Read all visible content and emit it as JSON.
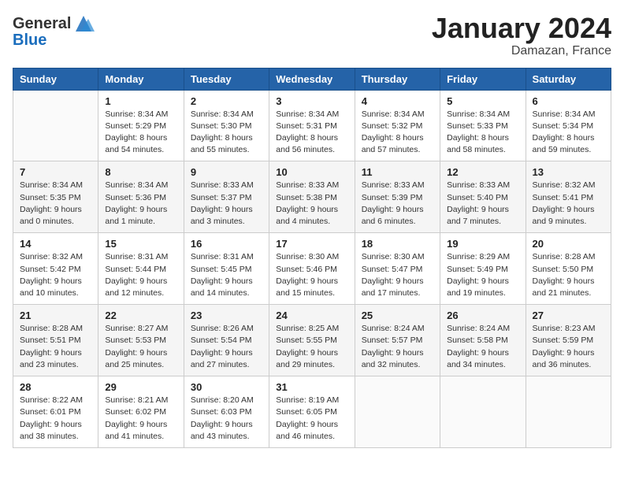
{
  "header": {
    "logo_general": "General",
    "logo_blue": "Blue",
    "month": "January 2024",
    "location": "Damazan, France"
  },
  "weekdays": [
    "Sunday",
    "Monday",
    "Tuesday",
    "Wednesday",
    "Thursday",
    "Friday",
    "Saturday"
  ],
  "weeks": [
    [
      {
        "day": "",
        "content": ""
      },
      {
        "day": "1",
        "content": "Sunrise: 8:34 AM\nSunset: 5:29 PM\nDaylight: 8 hours\nand 54 minutes."
      },
      {
        "day": "2",
        "content": "Sunrise: 8:34 AM\nSunset: 5:30 PM\nDaylight: 8 hours\nand 55 minutes."
      },
      {
        "day": "3",
        "content": "Sunrise: 8:34 AM\nSunset: 5:31 PM\nDaylight: 8 hours\nand 56 minutes."
      },
      {
        "day": "4",
        "content": "Sunrise: 8:34 AM\nSunset: 5:32 PM\nDaylight: 8 hours\nand 57 minutes."
      },
      {
        "day": "5",
        "content": "Sunrise: 8:34 AM\nSunset: 5:33 PM\nDaylight: 8 hours\nand 58 minutes."
      },
      {
        "day": "6",
        "content": "Sunrise: 8:34 AM\nSunset: 5:34 PM\nDaylight: 8 hours\nand 59 minutes."
      }
    ],
    [
      {
        "day": "7",
        "content": "Sunrise: 8:34 AM\nSunset: 5:35 PM\nDaylight: 9 hours\nand 0 minutes."
      },
      {
        "day": "8",
        "content": "Sunrise: 8:34 AM\nSunset: 5:36 PM\nDaylight: 9 hours\nand 1 minute."
      },
      {
        "day": "9",
        "content": "Sunrise: 8:33 AM\nSunset: 5:37 PM\nDaylight: 9 hours\nand 3 minutes."
      },
      {
        "day": "10",
        "content": "Sunrise: 8:33 AM\nSunset: 5:38 PM\nDaylight: 9 hours\nand 4 minutes."
      },
      {
        "day": "11",
        "content": "Sunrise: 8:33 AM\nSunset: 5:39 PM\nDaylight: 9 hours\nand 6 minutes."
      },
      {
        "day": "12",
        "content": "Sunrise: 8:33 AM\nSunset: 5:40 PM\nDaylight: 9 hours\nand 7 minutes."
      },
      {
        "day": "13",
        "content": "Sunrise: 8:32 AM\nSunset: 5:41 PM\nDaylight: 9 hours\nand 9 minutes."
      }
    ],
    [
      {
        "day": "14",
        "content": "Sunrise: 8:32 AM\nSunset: 5:42 PM\nDaylight: 9 hours\nand 10 minutes."
      },
      {
        "day": "15",
        "content": "Sunrise: 8:31 AM\nSunset: 5:44 PM\nDaylight: 9 hours\nand 12 minutes."
      },
      {
        "day": "16",
        "content": "Sunrise: 8:31 AM\nSunset: 5:45 PM\nDaylight: 9 hours\nand 14 minutes."
      },
      {
        "day": "17",
        "content": "Sunrise: 8:30 AM\nSunset: 5:46 PM\nDaylight: 9 hours\nand 15 minutes."
      },
      {
        "day": "18",
        "content": "Sunrise: 8:30 AM\nSunset: 5:47 PM\nDaylight: 9 hours\nand 17 minutes."
      },
      {
        "day": "19",
        "content": "Sunrise: 8:29 AM\nSunset: 5:49 PM\nDaylight: 9 hours\nand 19 minutes."
      },
      {
        "day": "20",
        "content": "Sunrise: 8:28 AM\nSunset: 5:50 PM\nDaylight: 9 hours\nand 21 minutes."
      }
    ],
    [
      {
        "day": "21",
        "content": "Sunrise: 8:28 AM\nSunset: 5:51 PM\nDaylight: 9 hours\nand 23 minutes."
      },
      {
        "day": "22",
        "content": "Sunrise: 8:27 AM\nSunset: 5:53 PM\nDaylight: 9 hours\nand 25 minutes."
      },
      {
        "day": "23",
        "content": "Sunrise: 8:26 AM\nSunset: 5:54 PM\nDaylight: 9 hours\nand 27 minutes."
      },
      {
        "day": "24",
        "content": "Sunrise: 8:25 AM\nSunset: 5:55 PM\nDaylight: 9 hours\nand 29 minutes."
      },
      {
        "day": "25",
        "content": "Sunrise: 8:24 AM\nSunset: 5:57 PM\nDaylight: 9 hours\nand 32 minutes."
      },
      {
        "day": "26",
        "content": "Sunrise: 8:24 AM\nSunset: 5:58 PM\nDaylight: 9 hours\nand 34 minutes."
      },
      {
        "day": "27",
        "content": "Sunrise: 8:23 AM\nSunset: 5:59 PM\nDaylight: 9 hours\nand 36 minutes."
      }
    ],
    [
      {
        "day": "28",
        "content": "Sunrise: 8:22 AM\nSunset: 6:01 PM\nDaylight: 9 hours\nand 38 minutes."
      },
      {
        "day": "29",
        "content": "Sunrise: 8:21 AM\nSunset: 6:02 PM\nDaylight: 9 hours\nand 41 minutes."
      },
      {
        "day": "30",
        "content": "Sunrise: 8:20 AM\nSunset: 6:03 PM\nDaylight: 9 hours\nand 43 minutes."
      },
      {
        "day": "31",
        "content": "Sunrise: 8:19 AM\nSunset: 6:05 PM\nDaylight: 9 hours\nand 46 minutes."
      },
      {
        "day": "",
        "content": ""
      },
      {
        "day": "",
        "content": ""
      },
      {
        "day": "",
        "content": ""
      }
    ]
  ]
}
